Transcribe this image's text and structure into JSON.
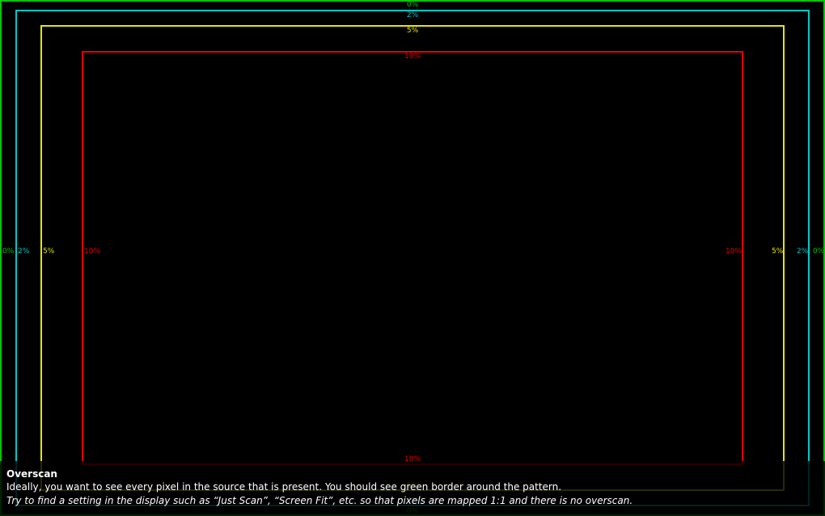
{
  "pattern": {
    "colors": {
      "p0": "#00c800",
      "p2": "#00c8c8",
      "p5": "#e6e600",
      "p10": "#e60000"
    },
    "labels": {
      "p0": "0%",
      "p2": "2%",
      "p5": "5%",
      "p10": "10%"
    }
  },
  "info": {
    "title": "Overscan",
    "description": "Ideally, you want to see every pixel in the source that is present. You should see green border around the pattern.",
    "hint": "Try to find a setting in the display such as “Just Scan”, “Screen Fit”, etc. so that pixels are mapped 1:1 and there is no overscan."
  }
}
